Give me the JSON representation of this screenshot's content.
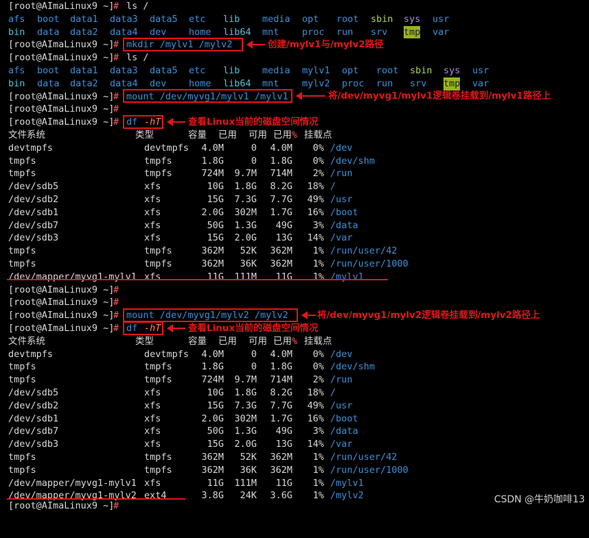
{
  "prompt": "[root@AImaLinux9 ~]",
  "cmd1": "ls /",
  "ls1": {
    "row1": [
      "afs",
      "boot",
      "data1",
      "data3",
      "data5",
      "etc",
      "lib",
      "media",
      "opt",
      "root",
      "sbin",
      "sys",
      "usr"
    ],
    "row2": [
      "bin",
      "data",
      "data2",
      "data4",
      "dev",
      "home",
      "lib64",
      "mnt",
      "proc",
      "run",
      "srv",
      "tmp",
      "var"
    ]
  },
  "cmd2": "mkdir /mylv1 /mylv2",
  "cmd3": "ls /",
  "ls2": {
    "row1": [
      "afs",
      "boot",
      "data1",
      "data3",
      "data5",
      "etc",
      "lib",
      "media",
      "mylv1",
      "opt",
      "root",
      "sbin",
      "sys",
      "usr"
    ],
    "row2": [
      "bin",
      "data",
      "data2",
      "data4",
      "dev",
      "home",
      "lib64",
      "mnt",
      "mylv2",
      "proc",
      "run",
      "srv",
      "tmp",
      "var"
    ]
  },
  "cmd4": "mount /dev/myvg1/mylv1 /mylv1",
  "cmd5_df": "df",
  "cmd5_opt": "-hT",
  "df_header": [
    "文件系统",
    "类型",
    "容量",
    "已用",
    "可用",
    "已用%",
    "挂载点"
  ],
  "df1": [
    [
      "devtmpfs",
      "devtmpfs",
      "4.0M",
      "0",
      "4.0M",
      "0%",
      "/dev"
    ],
    [
      "tmpfs",
      "tmpfs",
      "1.8G",
      "0",
      "1.8G",
      "0%",
      "/dev/shm"
    ],
    [
      "tmpfs",
      "tmpfs",
      "724M",
      "9.7M",
      "714M",
      "2%",
      "/run"
    ],
    [
      "/dev/sdb5",
      "xfs",
      "10G",
      "1.8G",
      "8.2G",
      "18%",
      "/"
    ],
    [
      "/dev/sdb2",
      "xfs",
      "15G",
      "7.3G",
      "7.7G",
      "49%",
      "/usr"
    ],
    [
      "/dev/sdb1",
      "xfs",
      "2.0G",
      "302M",
      "1.7G",
      "16%",
      "/boot"
    ],
    [
      "/dev/sdb7",
      "xfs",
      "50G",
      "1.3G",
      "49G",
      "3%",
      "/data"
    ],
    [
      "/dev/sdb3",
      "xfs",
      "15G",
      "2.0G",
      "13G",
      "14%",
      "/var"
    ],
    [
      "tmpfs",
      "tmpfs",
      "362M",
      "52K",
      "362M",
      "1%",
      "/run/user/42"
    ],
    [
      "tmpfs",
      "tmpfs",
      "362M",
      "36K",
      "362M",
      "1%",
      "/run/user/1000"
    ],
    [
      "/dev/mapper/myvg1-mylv1",
      "xfs",
      "11G",
      "111M",
      "11G",
      "1%",
      "/mylv1"
    ]
  ],
  "cmd6": "mount /dev/myvg1/mylv2 /mylv2",
  "df2": [
    [
      "devtmpfs",
      "devtmpfs",
      "4.0M",
      "0",
      "4.0M",
      "0%",
      "/dev"
    ],
    [
      "tmpfs",
      "tmpfs",
      "1.8G",
      "0",
      "1.8G",
      "0%",
      "/dev/shm"
    ],
    [
      "tmpfs",
      "tmpfs",
      "724M",
      "9.7M",
      "714M",
      "2%",
      "/run"
    ],
    [
      "/dev/sdb5",
      "xfs",
      "10G",
      "1.8G",
      "8.2G",
      "18%",
      "/"
    ],
    [
      "/dev/sdb2",
      "xfs",
      "15G",
      "7.3G",
      "7.7G",
      "49%",
      "/usr"
    ],
    [
      "/dev/sdb1",
      "xfs",
      "2.0G",
      "302M",
      "1.7G",
      "16%",
      "/boot"
    ],
    [
      "/dev/sdb7",
      "xfs",
      "50G",
      "1.3G",
      "49G",
      "3%",
      "/data"
    ],
    [
      "/dev/sdb3",
      "xfs",
      "15G",
      "2.0G",
      "13G",
      "14%",
      "/var"
    ],
    [
      "tmpfs",
      "tmpfs",
      "362M",
      "52K",
      "362M",
      "1%",
      "/run/user/42"
    ],
    [
      "tmpfs",
      "tmpfs",
      "362M",
      "36K",
      "362M",
      "1%",
      "/run/user/1000"
    ],
    [
      "/dev/mapper/myvg1-mylv1",
      "xfs",
      "11G",
      "111M",
      "11G",
      "1%",
      "/mylv1"
    ],
    [
      "/dev/mapper/myvg1-mylv2",
      "ext4",
      "3.8G",
      "24K",
      "3.6G",
      "1%",
      "/mylv2"
    ]
  ],
  "notes": {
    "mkdir": "创建/mylv1与/mylv2路径",
    "mount1": "将/dev/myvg1/mylv1逻辑卷挂载到/mylv1路径上",
    "df": "查看Linux当前的磁盘空间情况",
    "mount2": "将/dev/myvg1/mylv2逻辑卷挂载到/mylv2路径上"
  },
  "watermark": "CSDN @牛奶咖啡13",
  "colors": {
    "background": "#000000",
    "text": "#d8d8d8",
    "directory": "#3b8fd6",
    "special_dir": "#a9d35a",
    "annotation": "#e21616"
  }
}
